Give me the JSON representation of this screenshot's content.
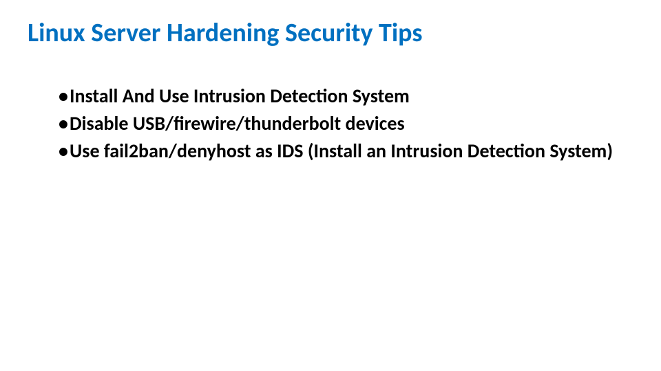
{
  "title": "Linux Server Hardening Security Tips",
  "bullets": [
    "Install And Use Intrusion Detection System",
    "Disable USB/firewire/thunderbolt devices",
    "Use fail2ban/denyhost as IDS (Install an Intrusion Detection System)"
  ]
}
